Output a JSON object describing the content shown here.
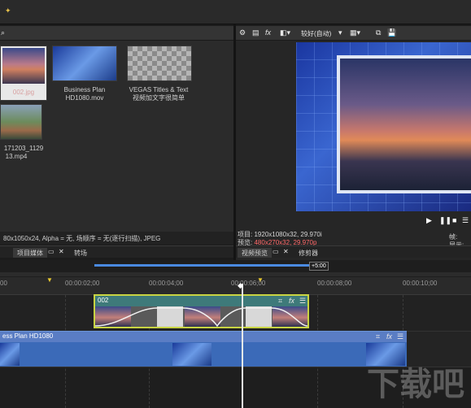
{
  "media": {
    "items": [
      {
        "name_line1": "002.jpg",
        "name_line2": ""
      },
      {
        "name_line1": "Business Plan",
        "name_line2": "HD1080.mov"
      },
      {
        "name_line1": "VEGAS Titles & Text",
        "name_line2": "视频加文字很简单"
      },
      {
        "name_line1": "171203_1129",
        "name_line2": "13.mp4"
      }
    ],
    "status": "80x1050x24, Alpha = 无, 场顺序 = 无(逐行扫描), JPEG"
  },
  "preview": {
    "quality": "较好(自动)",
    "project_label": "项目:",
    "project_value": "1920x1080x32, 29.970i",
    "preview_label": "预览:",
    "preview_value": "480x270x32, 29.970p",
    "frame_label": "帧:",
    "display_label": "显示:"
  },
  "tabs": {
    "left": [
      "项目媒体",
      "转场"
    ],
    "right": [
      "视频预览",
      "修剪器"
    ]
  },
  "timeline": {
    "loop_end": "+5:00",
    "ticks": [
      "00",
      "00:00:02;00",
      "00:00:04;00",
      "00:00:06;00",
      "00:00:08;00",
      "00:00:10;00"
    ],
    "clip1_name": "002",
    "clip2_name": "ess Plan HD1080"
  },
  "watermark": "下载吧"
}
